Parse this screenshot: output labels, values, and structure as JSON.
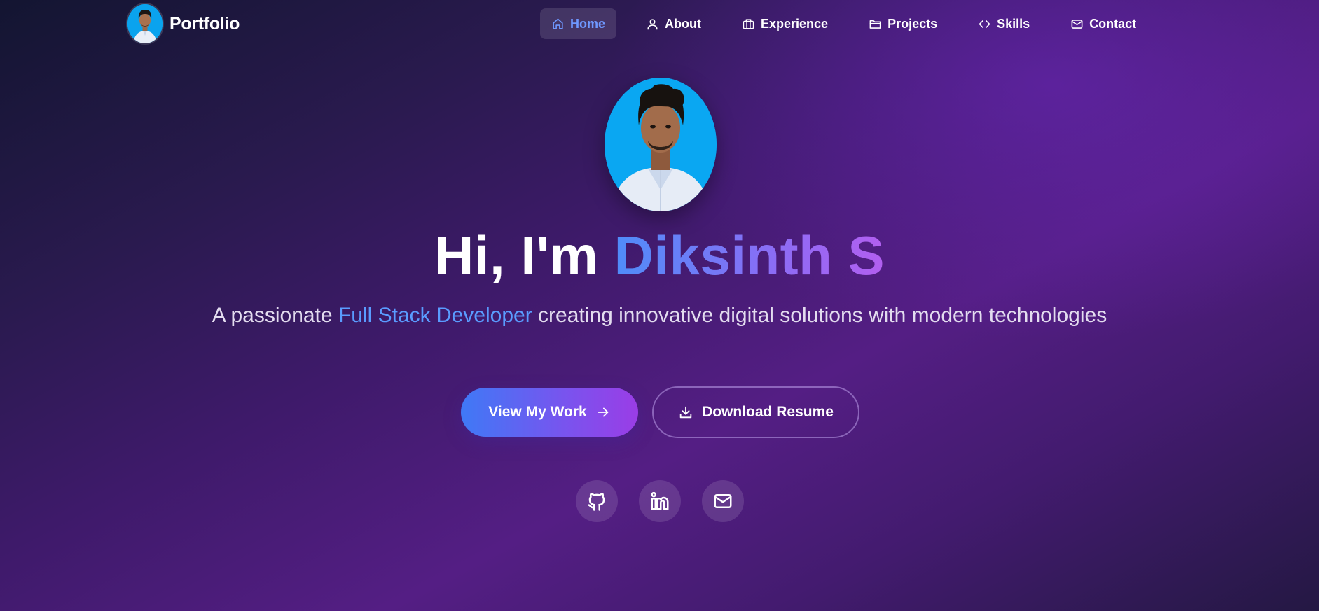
{
  "brand": {
    "title": "Portfolio"
  },
  "nav": {
    "items": [
      {
        "label": "Home",
        "icon": "home-icon",
        "active": true
      },
      {
        "label": "About",
        "icon": "user-icon",
        "active": false
      },
      {
        "label": "Experience",
        "icon": "briefcase-icon",
        "active": false
      },
      {
        "label": "Projects",
        "icon": "folder-icon",
        "active": false
      },
      {
        "label": "Skills",
        "icon": "code-icon",
        "active": false
      },
      {
        "label": "Contact",
        "icon": "mail-icon",
        "active": false
      }
    ]
  },
  "hero": {
    "greeting": "Hi, I'm ",
    "name": "Diksinth S",
    "subtitle_prefix": "A passionate ",
    "subtitle_highlight": "Full Stack Developer",
    "subtitle_suffix": " creating innovative digital solutions with modern technologies",
    "primary_button": "View My Work",
    "secondary_button": "Download Resume"
  },
  "socials": [
    {
      "icon": "github-icon"
    },
    {
      "icon": "linkedin-icon"
    },
    {
      "icon": "mail-icon"
    }
  ],
  "colors": {
    "accent_blue": "#5a9cff",
    "active_nav": "#6f98ff",
    "gradient_start": "#3f79f6",
    "gradient_end": "#9a3de6",
    "avatar_bg": "#0aa7f2"
  }
}
